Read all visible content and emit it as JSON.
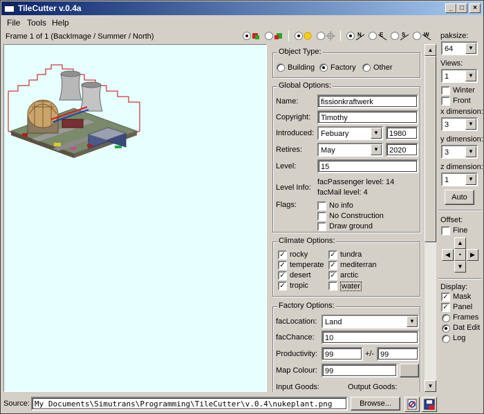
{
  "window": {
    "title": "TileCutter v.0.4a",
    "controls": {
      "minimize": "_",
      "maximize": "□",
      "close": "×"
    }
  },
  "menu": [
    "File",
    "Tools",
    "Help"
  ],
  "frame_label": "Frame 1 of 1 (BackImage / Summer / North)",
  "toolbar": {
    "view_modes": [
      "back",
      "front"
    ],
    "season_modes": [
      "summer",
      "winter",
      "move"
    ],
    "directions": [
      "N",
      "E",
      "S",
      "W"
    ]
  },
  "object_type": {
    "group_label": "Object Type:",
    "options": [
      "Building",
      "Factory",
      "Other"
    ],
    "selected": "Factory"
  },
  "global_options": {
    "group_label": "Global Options:",
    "name_label": "Name:",
    "name_value": "fissionkraftwerk",
    "copyright_label": "Copyright:",
    "copyright_value": "Timothy",
    "introduced_label": "Introduced:",
    "introduced_month": "Febuary",
    "introduced_year": "1980",
    "retires_label": "Retires:",
    "retires_month": "May",
    "retires_year": "2020",
    "level_label": "Level:",
    "level_value": "15",
    "levelinfo_label": "Level Info:",
    "levelinfo_line1": "facPassenger level: 14",
    "levelinfo_line2": "facMail level: 4",
    "flags_label": "Flags:",
    "flags": [
      {
        "label": "No info",
        "checked": false
      },
      {
        "label": "No Construction",
        "checked": false
      },
      {
        "label": "Draw ground",
        "checked": false
      }
    ]
  },
  "climate_options": {
    "group_label": "Climate Options:",
    "items": [
      {
        "label": "rocky",
        "checked": true
      },
      {
        "label": "tundra",
        "checked": true
      },
      {
        "label": "temperate",
        "checked": true
      },
      {
        "label": "mediterran",
        "checked": true
      },
      {
        "label": "desert",
        "checked": true
      },
      {
        "label": "arctic",
        "checked": true
      },
      {
        "label": "tropic",
        "checked": true
      },
      {
        "label": "water",
        "checked": false
      }
    ]
  },
  "factory_options": {
    "group_label": "Factory Options:",
    "location_label": "facLocation:",
    "location_value": "Land",
    "chance_label": "facChance:",
    "chance_value": "10",
    "productivity_label": "Productivity:",
    "productivity_value": "99",
    "plusminus_label": "+/-",
    "plusminus_value": "99",
    "mapcolour_label": "Map Colour:",
    "mapcolour_value": "99",
    "input_label": "Input Goods:",
    "output_label": "Output Goods:"
  },
  "right_panel": {
    "paksize_label": "paksize:",
    "paksize_value": "64",
    "views_label": "Views:",
    "views_value": "1",
    "winter_label": "Winter",
    "winter_checked": false,
    "front_label": "Front",
    "front_checked": false,
    "xdim_label": "x dimension:",
    "xdim_value": "3",
    "ydim_label": "y dimension:",
    "ydim_value": "3",
    "zdim_label": "z dimension:",
    "zdim_value": "1",
    "auto_label": "Auto",
    "offset_label": "Offset:",
    "fine_label": "Fine",
    "fine_checked": false,
    "display_label": "Display:",
    "mask_label": "Mask",
    "mask_checked": true,
    "panel_label": "Panel",
    "panel_checked": true,
    "frames_label": "Frames",
    "datedit_label": "Dat Edit",
    "log_label": "Log",
    "display_selected": "Dat Edit"
  },
  "status": {
    "source_label": "Source:",
    "source_path": "My Documents\\Simutrans\\Programming\\TileCutter\\v.0.4\\nukeplant.png",
    "browse_label": "Browse..."
  },
  "colors": {
    "canvas_bg": "#e6ffff",
    "title_start": "#0a246a",
    "title_end": "#a6caf0",
    "mask_line": "#cc0000"
  }
}
